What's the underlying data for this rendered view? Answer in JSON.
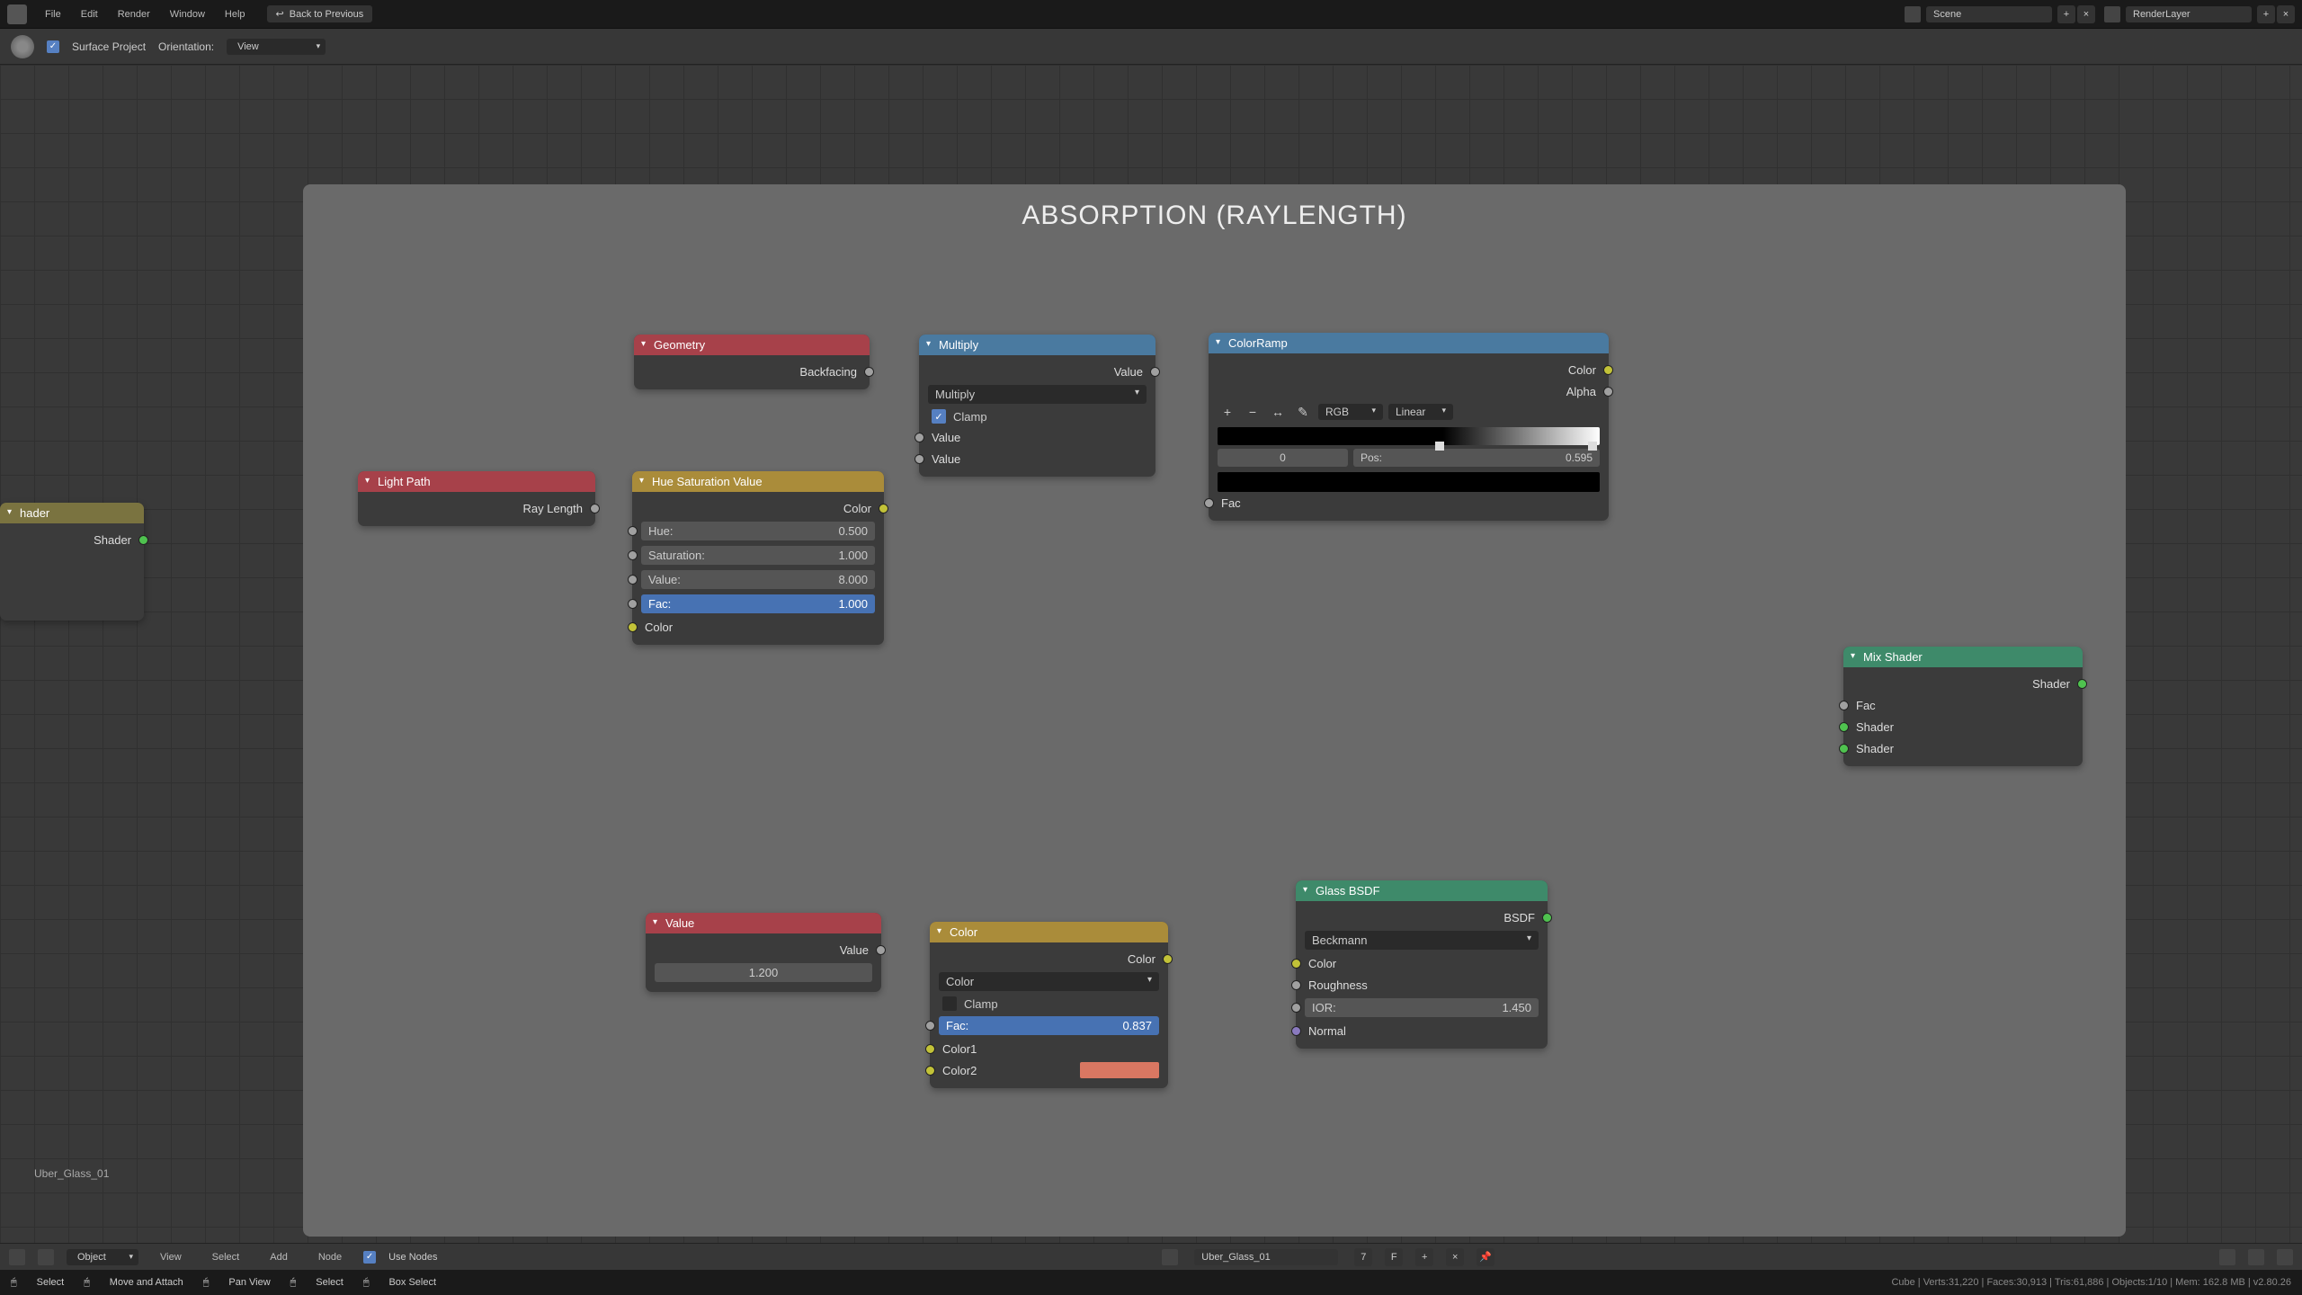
{
  "menu": {
    "file": "File",
    "edit": "Edit",
    "render": "Render",
    "window": "Window",
    "help": "Help",
    "back": "Back to Previous"
  },
  "top": {
    "scene": "Scene",
    "layer": "RenderLayer"
  },
  "sub": {
    "surface": "Surface Project",
    "orient": "Orientation:",
    "view": "View"
  },
  "frame": {
    "title": "ABSORPTION (RAYLENGTH)"
  },
  "nodes": {
    "shader_in": {
      "out": "Shader",
      "title": "hader"
    },
    "lightpath": {
      "title": "Light Path",
      "out": "Ray Length"
    },
    "geometry": {
      "title": "Geometry",
      "out": "Backfacing"
    },
    "hsv": {
      "title": "Hue Saturation Value",
      "color": "Color",
      "hue_l": "Hue:",
      "hue_v": "0.500",
      "sat_l": "Saturation:",
      "sat_v": "1.000",
      "val_l": "Value:",
      "val_v": "8.000",
      "fac_l": "Fac:",
      "fac_v": "1.000",
      "in_color": "Color"
    },
    "mult": {
      "title": "Multiply",
      "out": "Value",
      "op": "Multiply",
      "clamp": "Clamp",
      "in1": "Value",
      "in2": "Value"
    },
    "ramp": {
      "title": "ColorRamp",
      "color": "Color",
      "alpha": "Alpha",
      "mode": "RGB",
      "interp": "Linear",
      "idx": "0",
      "pos_l": "Pos:",
      "pos_v": "0.595",
      "fac": "Fac"
    },
    "value": {
      "title": "Value",
      "out": "Value",
      "val": "1.200"
    },
    "mix": {
      "title": "Color",
      "out": "Color",
      "mode": "Color",
      "clamp": "Clamp",
      "fac_l": "Fac:",
      "fac_v": "0.837",
      "c1": "Color1",
      "c2": "Color2"
    },
    "glass": {
      "title": "Glass BSDF",
      "out": "BSDF",
      "dist": "Beckmann",
      "color": "Color",
      "rough": "Roughness",
      "ior_l": "IOR:",
      "ior_v": "1.450",
      "normal": "Normal"
    },
    "mixsh": {
      "title": "Mix Shader",
      "out": "Shader",
      "fac": "Fac",
      "s1": "Shader",
      "s2": "Shader"
    }
  },
  "mat": "Uber_Glass_01",
  "bot": {
    "obj": "Object",
    "view": "View",
    "select": "Select",
    "add": "Add",
    "node": "Node",
    "use": "Use Nodes",
    "matname": "Uber_Glass_01",
    "idx": "7",
    "f": "F"
  },
  "status": {
    "select": "Select",
    "move": "Move and Attach",
    "pan": "Pan View",
    "sel2": "Select",
    "box": "Box Select",
    "stats": "Cube | Verts:31,220 | Faces:30,913 | Tris:61,886 | Objects:1/10 | Mem: 162.8 MB | v2.80.26"
  }
}
